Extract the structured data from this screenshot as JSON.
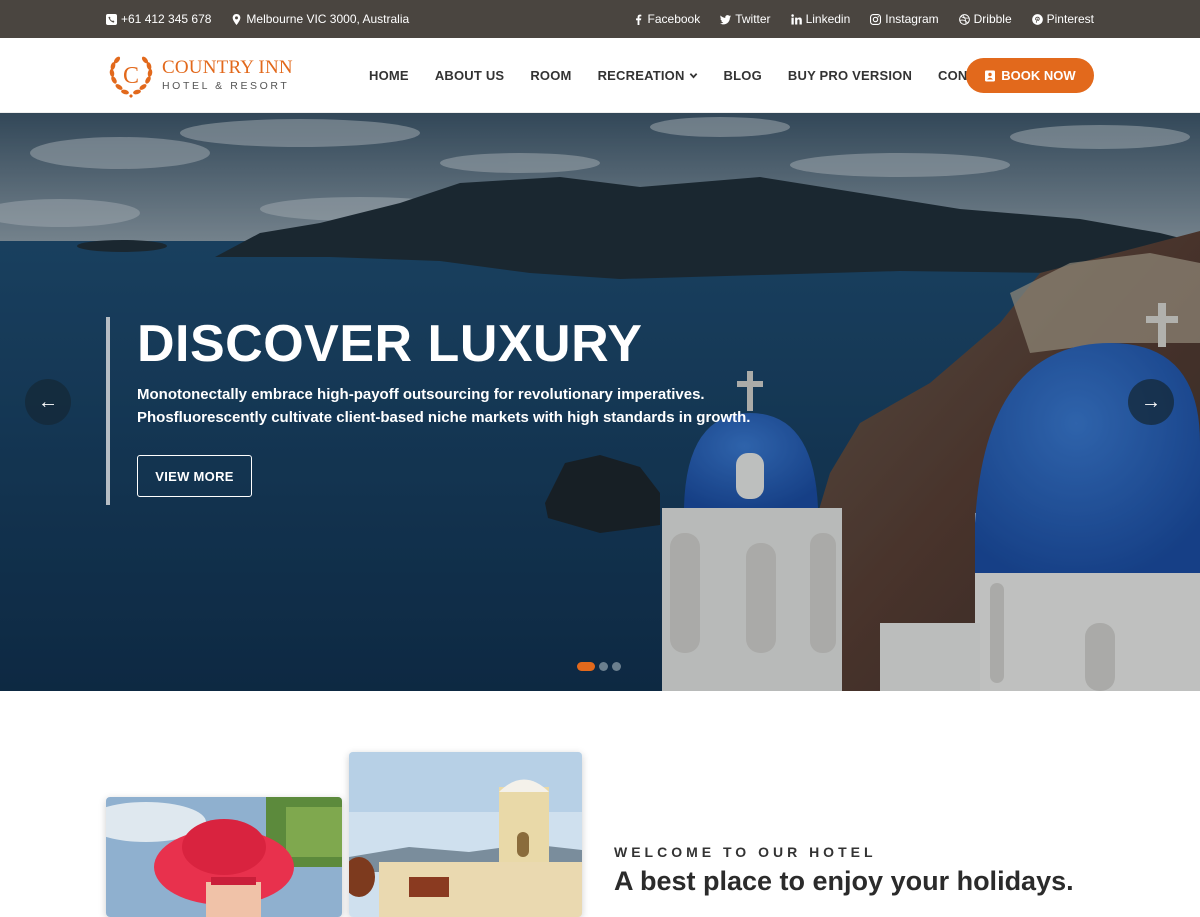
{
  "topbar": {
    "phone": "+61 412 345 678",
    "address": "Melbourne VIC 3000, Australia",
    "social": [
      {
        "label": "Facebook",
        "icon": "facebook-icon"
      },
      {
        "label": "Twitter",
        "icon": "twitter-icon"
      },
      {
        "label": "Linkedin",
        "icon": "linkedin-icon"
      },
      {
        "label": "Instagram",
        "icon": "instagram-icon"
      },
      {
        "label": "Dribble",
        "icon": "dribbble-icon"
      },
      {
        "label": "Pinterest",
        "icon": "pinterest-icon"
      }
    ]
  },
  "header": {
    "logo_letter": "C",
    "logo_name": "COUNTRY INN",
    "logo_sub": "HOTEL & RESORT",
    "nav": [
      "HOME",
      "ABOUT US",
      "ROOM",
      "RECREATION",
      "BLOG",
      "BUY PRO VERSION",
      "CONTACT"
    ],
    "book_label": "BOOK NOW"
  },
  "hero": {
    "title": "DISCOVER LUXURY",
    "text": "Monotonectally embrace high-payoff outsourcing for revolutionary imperatives. Phosfluorescently cultivate client-based niche markets with high standards in growth.",
    "button": "VIEW MORE",
    "prev": "←",
    "next": "→",
    "slides": 3,
    "active_slide": 1
  },
  "welcome": {
    "kicker": "WELCOME TO OUR HOTEL",
    "title": "A best place to enjoy your holidays."
  },
  "colors": {
    "accent": "#e2691c",
    "topbar": "#4a4540"
  }
}
